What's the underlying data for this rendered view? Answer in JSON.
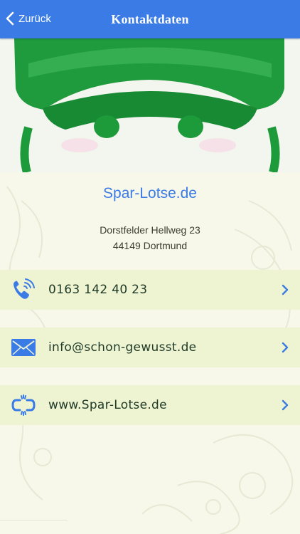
{
  "nav": {
    "back_label": "Zurück",
    "title": "Kontaktdaten"
  },
  "company": {
    "name": "Spar-Lotse.de",
    "address_line1": "Dorstfelder Hellweg 23",
    "address_line2": "44149 Dortmund"
  },
  "contacts": [
    {
      "icon": "phone-icon",
      "label": "0163 142 40 23"
    },
    {
      "icon": "mail-icon",
      "label": "info@schon-gewusst.de"
    },
    {
      "icon": "link-icon",
      "label": "www.Spar-Lotse.de"
    }
  ],
  "colors": {
    "accent": "#3b7be6",
    "row_bg": "#eef3d2",
    "page_bg": "#f7f8ea",
    "hero_green": "#1d9a3a"
  }
}
